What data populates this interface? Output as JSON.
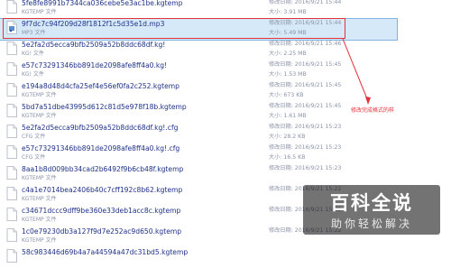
{
  "files": [
    {
      "name": "5fe8fe8991b7344ca036cebe5e3ac1be.kgtemp",
      "type": "KGTEMP 文件",
      "date": "修改日期: 2016/9/21 15:44",
      "size": "大小: 3.91 MB",
      "icon": "file-icon"
    },
    {
      "name": "9f7dc7c94f209d28f1812f1c5d35e1d.mp3",
      "type": "MP3 文件",
      "date": "修改日期: 2016/9/21 15:44",
      "size": "大小: 5.49 MB",
      "icon": "mp3-file-icon",
      "selected": true
    },
    {
      "name": "5e2fa2d5ecca9bfb2509a52b8ddc68df.kg!",
      "type": "KG! 文件",
      "date": "修改日期: 2016/9/21 15:46",
      "size": "大小: 2.25 MB",
      "icon": "file-icon"
    },
    {
      "name": "e57c73291346bb891de2098afe8ff4a0.kg!",
      "type": "KG! 文件",
      "date": "修改日期: 2016/9/21 15:45",
      "size": "大小: 1.53 MB",
      "icon": "file-icon"
    },
    {
      "name": "e194a8d48d4cfa25ef4e56ef0fa2c252.kgtemp",
      "type": "KGTEMP 文件",
      "date": "修改日期: 2016/9/21 15:45",
      "size": "大小: 673 KB",
      "icon": "file-icon"
    },
    {
      "name": "5bd7a51dbe43995d612c81d5e978f18b.kgtemp",
      "type": "KGTEMP 文件",
      "date": "修改日期: 2016/9/21 15:45",
      "size": "大小: 1.61 MB",
      "icon": "file-icon"
    },
    {
      "name": "5e2fa2d5ecca9bfb2509a52b8ddc68df.kg!.cfg",
      "type": "CFG 文件",
      "date": "修改日期: 2016/9/21 15:23",
      "size": "大小: 28.2 KB",
      "icon": "file-icon"
    },
    {
      "name": "e57c73291346bb891de2098afe8ff4a0.kg!.cfg",
      "type": "CFG 文件",
      "date": "修改日期: 2016/9/21 15:23",
      "size": "大小: 16.5 KB",
      "icon": "file-icon"
    },
    {
      "name": "8aa1b8d009bb34cad2b6492f9b6cb48f.kgtemp",
      "type": "KGTEMP 文件",
      "date": "修改日期: 2016/9/21 15:23",
      "size": "",
      "icon": "file-icon"
    },
    {
      "name": "c4a1e7014bea2406b40c7cff192c8b62.kgtemp",
      "type": "KGTEMP 文件",
      "date": "修改日期: 2016/9/21 15:22",
      "size": "",
      "icon": "file-icon"
    },
    {
      "name": "c34671dccc9dff9be360e33deb1acc8c.kgtemp",
      "type": "KGTEMP 文件",
      "date": "修改日期: 2016/9/21 15:22",
      "size": "",
      "icon": "file-icon"
    },
    {
      "name": "1c0e79230db3a127f9d7e252ac9d650.kgtemp",
      "type": "KGTEMP 文件",
      "date": "修改日期: 2016/9/21 15:22",
      "size": "",
      "icon": "file-icon"
    },
    {
      "name": "58c983446d69b4a7a44594a47dc31bd5.kgtemp",
      "type": "",
      "date": "",
      "size": "",
      "icon": "file-icon"
    }
  ],
  "annotation": "修改完成格式的样",
  "watermark": {
    "title": "百科全说",
    "subtitle": "助你轻松解决"
  },
  "colors": {
    "text": "#1e3287",
    "meta": "#8a93a8",
    "selection": "#d6e9f8",
    "highlight": "#e4323b"
  }
}
